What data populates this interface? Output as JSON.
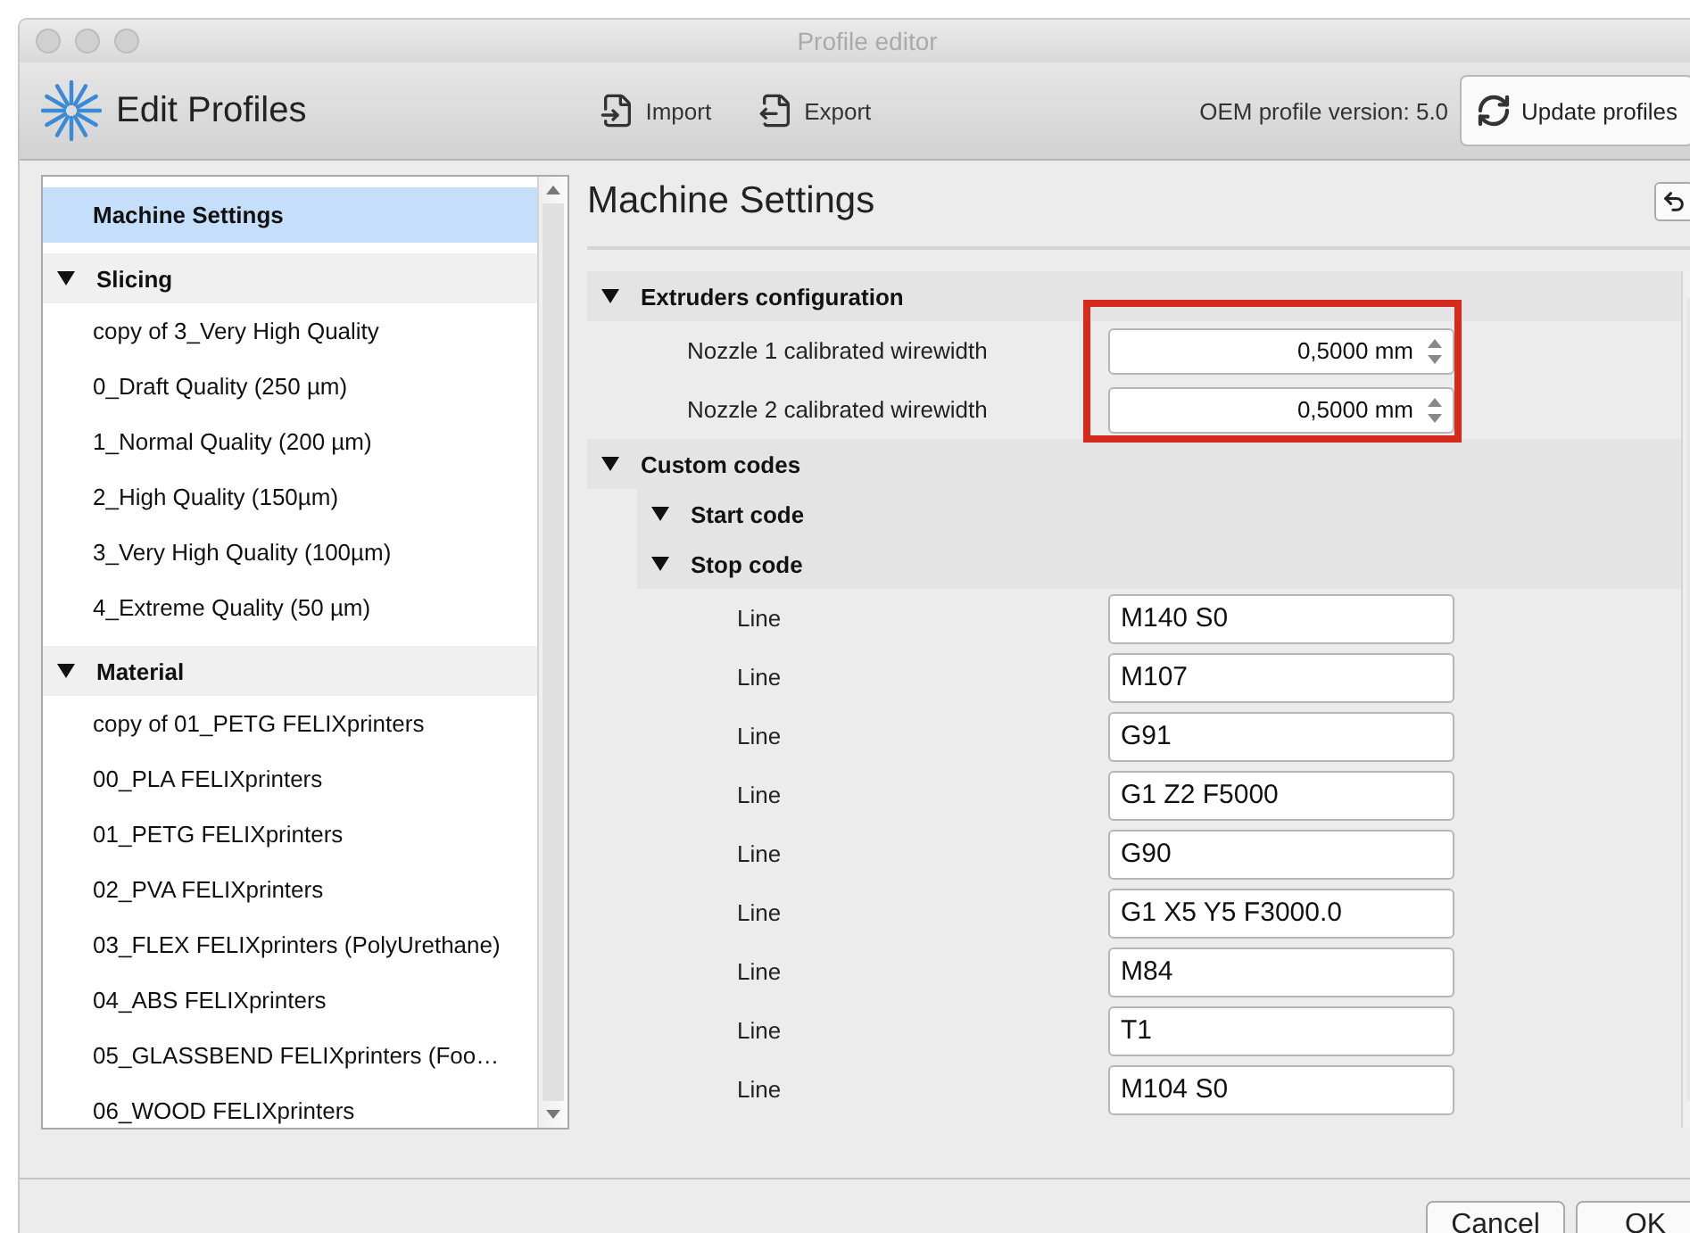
{
  "window": {
    "title": "Profile editor"
  },
  "toolbar": {
    "title": "Edit Profiles",
    "actions": [
      {
        "label": "Import",
        "kind": "import"
      },
      {
        "label": "Export",
        "kind": "export"
      }
    ],
    "oem_version": "OEM profile version: 5.0",
    "update_button": "Update profiles"
  },
  "sidebar": {
    "items": [
      {
        "label": "Machine Settings",
        "kind": "item",
        "selected": true
      },
      {
        "label": "Slicing",
        "kind": "group",
        "expanded": true,
        "children": [
          {
            "label": "copy of 3_Very High Quality",
            "selected": false
          },
          {
            "label": "0_Draft Quality (250 µm)",
            "selected": false
          },
          {
            "label": "1_Normal Quality (200 µm)",
            "selected": false
          },
          {
            "label": "2_High Quality (150µm)",
            "selected": false
          },
          {
            "label": "3_Very High Quality (100µm)",
            "selected": false
          },
          {
            "label": "4_Extreme Quality (50 µm)",
            "selected": false
          }
        ]
      },
      {
        "label": "Material",
        "kind": "group",
        "expanded": true,
        "children": [
          {
            "label": "copy of 01_PETG FELIXprinters",
            "selected": false
          },
          {
            "label": "00_PLA FELIXprinters",
            "selected": false
          },
          {
            "label": "01_PETG FELIXprinters",
            "selected": false
          },
          {
            "label": "02_PVA FELIXprinters",
            "selected": false
          },
          {
            "label": "03_FLEX FELIXprinters (PolyUrethane)",
            "selected": false
          },
          {
            "label": "04_ABS FELIXprinters",
            "selected": false
          },
          {
            "label": "05_GLASSBEND FELIXprinters (Foo…",
            "selected": false
          },
          {
            "label": "06_WOOD FELIXprinters",
            "selected": false
          }
        ]
      }
    ]
  },
  "panel": {
    "title": "Machine Settings",
    "sections": [
      {
        "label": "Extruders configuration",
        "expanded": true,
        "highlighted": true,
        "fields": [
          {
            "label": "Nozzle 1 calibrated wirewidth",
            "value": "0,5000 mm",
            "kind": "spin"
          },
          {
            "label": "Nozzle 2 calibrated wirewidth",
            "value": "0,5000 mm",
            "kind": "spin"
          }
        ]
      },
      {
        "label": "Custom codes",
        "expanded": true,
        "children": [
          {
            "label": "Start code",
            "expanded": true
          },
          {
            "label": "Stop code",
            "expanded": true,
            "fields": [
              {
                "label": "Line",
                "value": "M140 S0",
                "kind": "text"
              },
              {
                "label": "Line",
                "value": "M107",
                "kind": "text"
              },
              {
                "label": "Line",
                "value": "G91",
                "kind": "text"
              },
              {
                "label": "Line",
                "value": "G1 Z2 F5000",
                "kind": "text"
              },
              {
                "label": "Line",
                "value": "G90",
                "kind": "text"
              },
              {
                "label": "Line",
                "value": "G1 X5 Y5 F3000.0",
                "kind": "text"
              },
              {
                "label": "Line",
                "value": "M84",
                "kind": "text"
              },
              {
                "label": "Line",
                "value": "T1",
                "kind": "text"
              },
              {
                "label": "Line",
                "value": "M104 S0",
                "kind": "text"
              }
            ]
          }
        ]
      }
    ]
  },
  "buttons": [
    "Cancel",
    "OK"
  ]
}
